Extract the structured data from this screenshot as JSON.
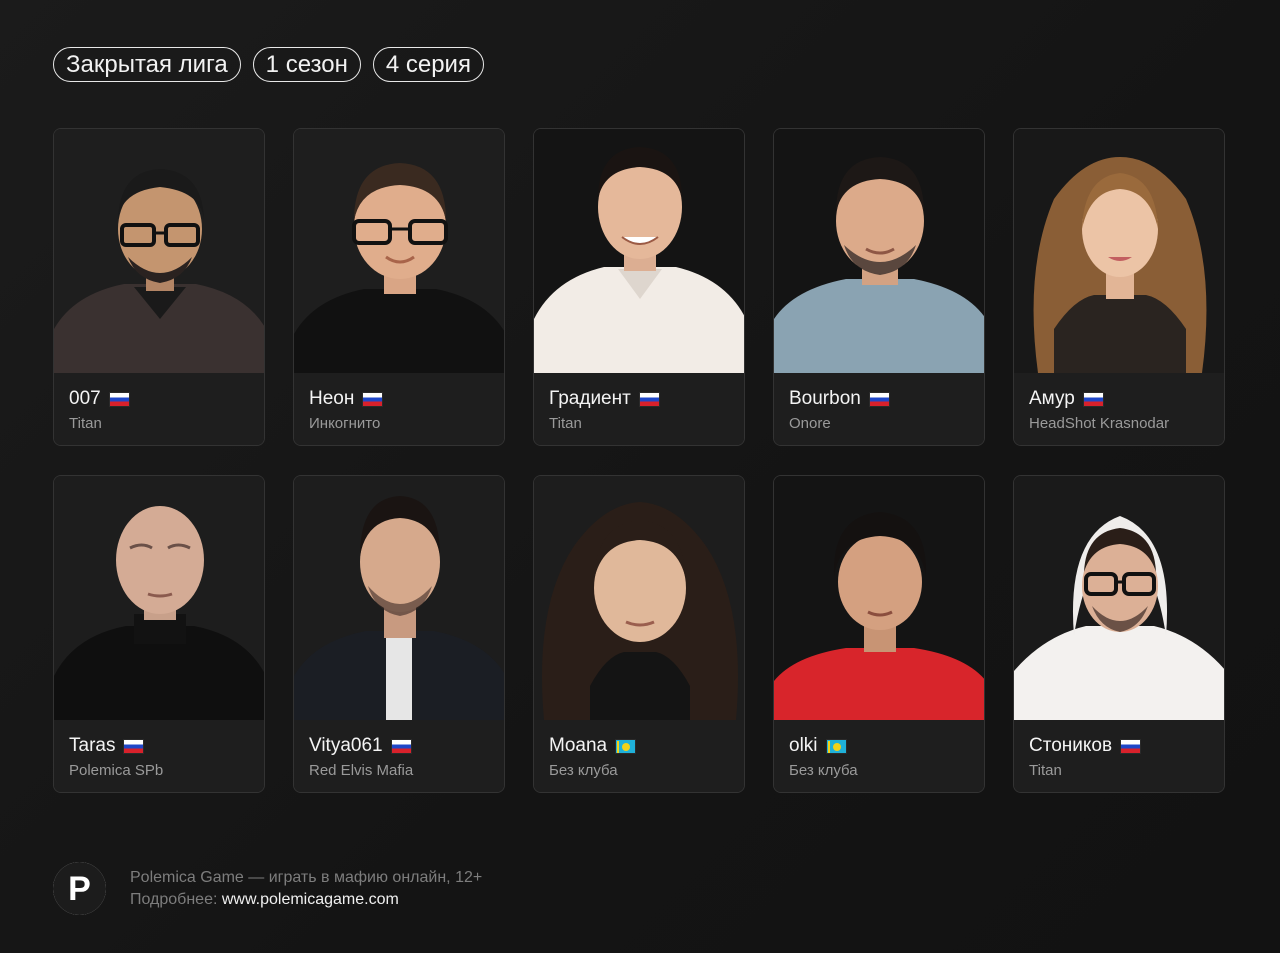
{
  "tags": [
    "Закрытая лига",
    "1 сезон",
    "4 серия"
  ],
  "players": [
    {
      "name": "007",
      "club": "Titan",
      "flag": "ru",
      "photo": "portrait-man-glasses-dark-shirt"
    },
    {
      "name": "Неон",
      "club": "Инкогнито",
      "flag": "ru",
      "photo": "portrait-man-glasses-black-shirt"
    },
    {
      "name": "Градиент",
      "club": "Titan",
      "flag": "ru",
      "photo": "portrait-man-white-polo"
    },
    {
      "name": "Bourbon",
      "club": "Onore",
      "flag": "ru",
      "photo": "portrait-man-grey-sweater"
    },
    {
      "name": "Амур",
      "club": "HeadShot Krasnodar",
      "flag": "ru",
      "photo": "portrait-woman-long-hair"
    },
    {
      "name": "Taras",
      "club": "Polemica SPb",
      "flag": "ru",
      "photo": "portrait-bald-man-turtleneck"
    },
    {
      "name": "Vitya061",
      "club": "Red Elvis Mafia",
      "flag": "ru",
      "photo": "portrait-man-black-jacket"
    },
    {
      "name": "Moana",
      "club": "Без клуба",
      "flag": "kz",
      "photo": "portrait-woman-curly-hair"
    },
    {
      "name": "olki",
      "club": "Без клуба",
      "flag": "kz",
      "photo": "portrait-man-red-tshirt"
    },
    {
      "name": "Стоников",
      "club": "Titan",
      "flag": "ru",
      "photo": "portrait-man-white-hoodie-glasses"
    }
  ],
  "footer": {
    "logo_letter": "P",
    "line1": "Polemica Game — играть в мафию онлайн, 12+",
    "line2_prefix": "Подробнее:",
    "url": "www.polemicagame.com"
  },
  "colors": {
    "background": "#151515",
    "card": "#1c1c1c",
    "club_text": "#9a9a9a",
    "tag_border": "#e8e8e8"
  }
}
